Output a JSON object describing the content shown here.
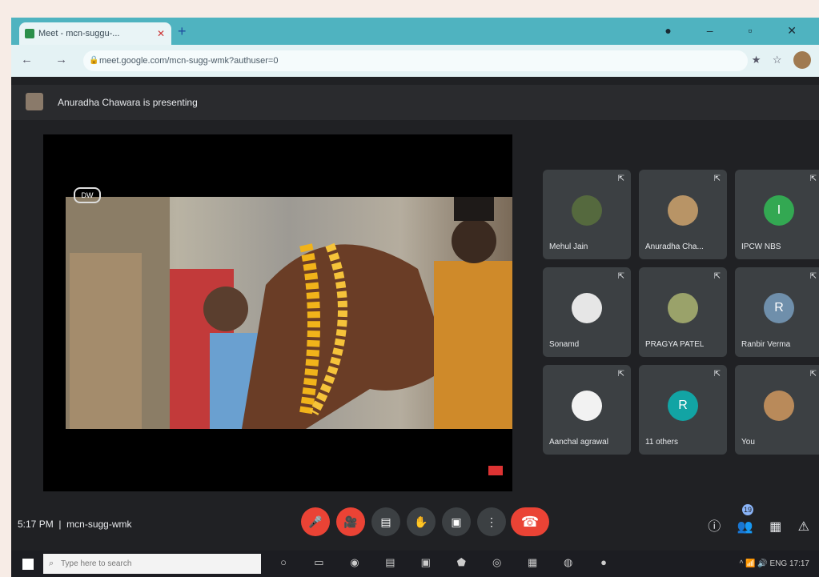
{
  "browser": {
    "tab_title": "Meet - mcn-suggu-...",
    "tab_close": "✕",
    "new_tab": "+",
    "url": "meet.google.com/mcn-sugg-wmk?authuser=0",
    "lock": "🔒",
    "nav": [
      "←",
      "→",
      "C"
    ],
    "actions": [
      "★",
      "☆"
    ],
    "window_controls": "● – ▫ ✕"
  },
  "meet": {
    "presenter_text": "Anuradha Chawara is presenting",
    "video_watermark": "DW",
    "participants": [
      {
        "name": "Mehul Jain",
        "initial": ""
      },
      {
        "name": "Anuradha Cha...",
        "initial": ""
      },
      {
        "name": "IPCW NBS",
        "initial": "I"
      },
      {
        "name": "Sonamd",
        "initial": ""
      },
      {
        "name": "PRAGYA PATEL",
        "initial": ""
      },
      {
        "name": "Ranbir Verma",
        "initial": "R"
      },
      {
        "name": "Aanchal agrawal",
        "initial": ""
      },
      {
        "name": "11 others",
        "initial": "R"
      },
      {
        "name": "You",
        "initial": ""
      }
    ],
    "pin_icon": "⇱",
    "meeting_time": "5:17 PM",
    "meeting_code": "mcn-sugg-wmk",
    "participants_badge": "19",
    "controls": {
      "mic": "🎤",
      "cam": "🎥",
      "cc": "▤",
      "raise": "✋",
      "present": "▣",
      "more": "⋮",
      "hangup": "☎"
    },
    "right_controls": [
      "ⓘ",
      "👥",
      "▦",
      "⚠"
    ]
  },
  "taskbar": {
    "search_placeholder": "Type here to search",
    "icons": [
      "○",
      "▭",
      "◉",
      "▤",
      "▣",
      "⬟",
      "◎",
      "▦",
      "◍",
      "●"
    ],
    "tray": "^ 📶 🔊 ENG 17:17"
  }
}
